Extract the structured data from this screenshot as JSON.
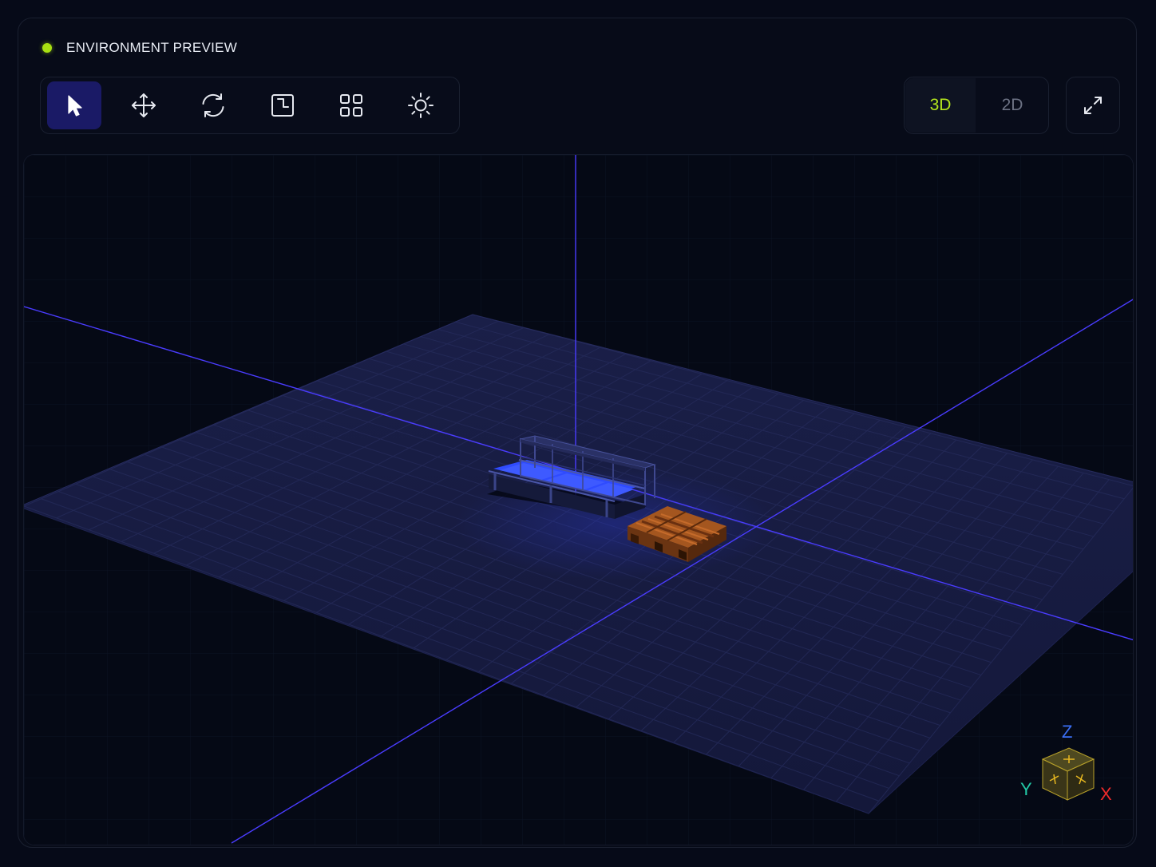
{
  "header": {
    "title": "ENVIRONMENT PREVIEW",
    "status_color": "#a8e012"
  },
  "toolbar": {
    "tools": [
      {
        "name": "select",
        "icon": "cursor-arrow-icon",
        "active": true
      },
      {
        "name": "move",
        "icon": "move-arrows-icon",
        "active": false
      },
      {
        "name": "rotate",
        "icon": "rotate-icon",
        "active": false
      },
      {
        "name": "scale",
        "icon": "scale-icon",
        "active": false
      },
      {
        "name": "grid",
        "icon": "grid-icon",
        "active": false
      },
      {
        "name": "lighting",
        "icon": "sun-icon",
        "active": false
      }
    ]
  },
  "view_mode": {
    "options": [
      "3D",
      "2D"
    ],
    "selected": "3D",
    "active_color": "#b5e61d"
  },
  "fullscreen": {
    "icon": "expand-icon"
  },
  "gizmo": {
    "z_label": "Z",
    "y_label": "Y",
    "x_label": "X",
    "z_color": "#3b6ff5",
    "y_color": "#23c9a7",
    "x_color": "#ef2a2a"
  },
  "scene": {
    "objects": [
      "conveyor",
      "pallet"
    ],
    "axis_color": "#4a3cff",
    "floor_color": "#1a1e45"
  }
}
